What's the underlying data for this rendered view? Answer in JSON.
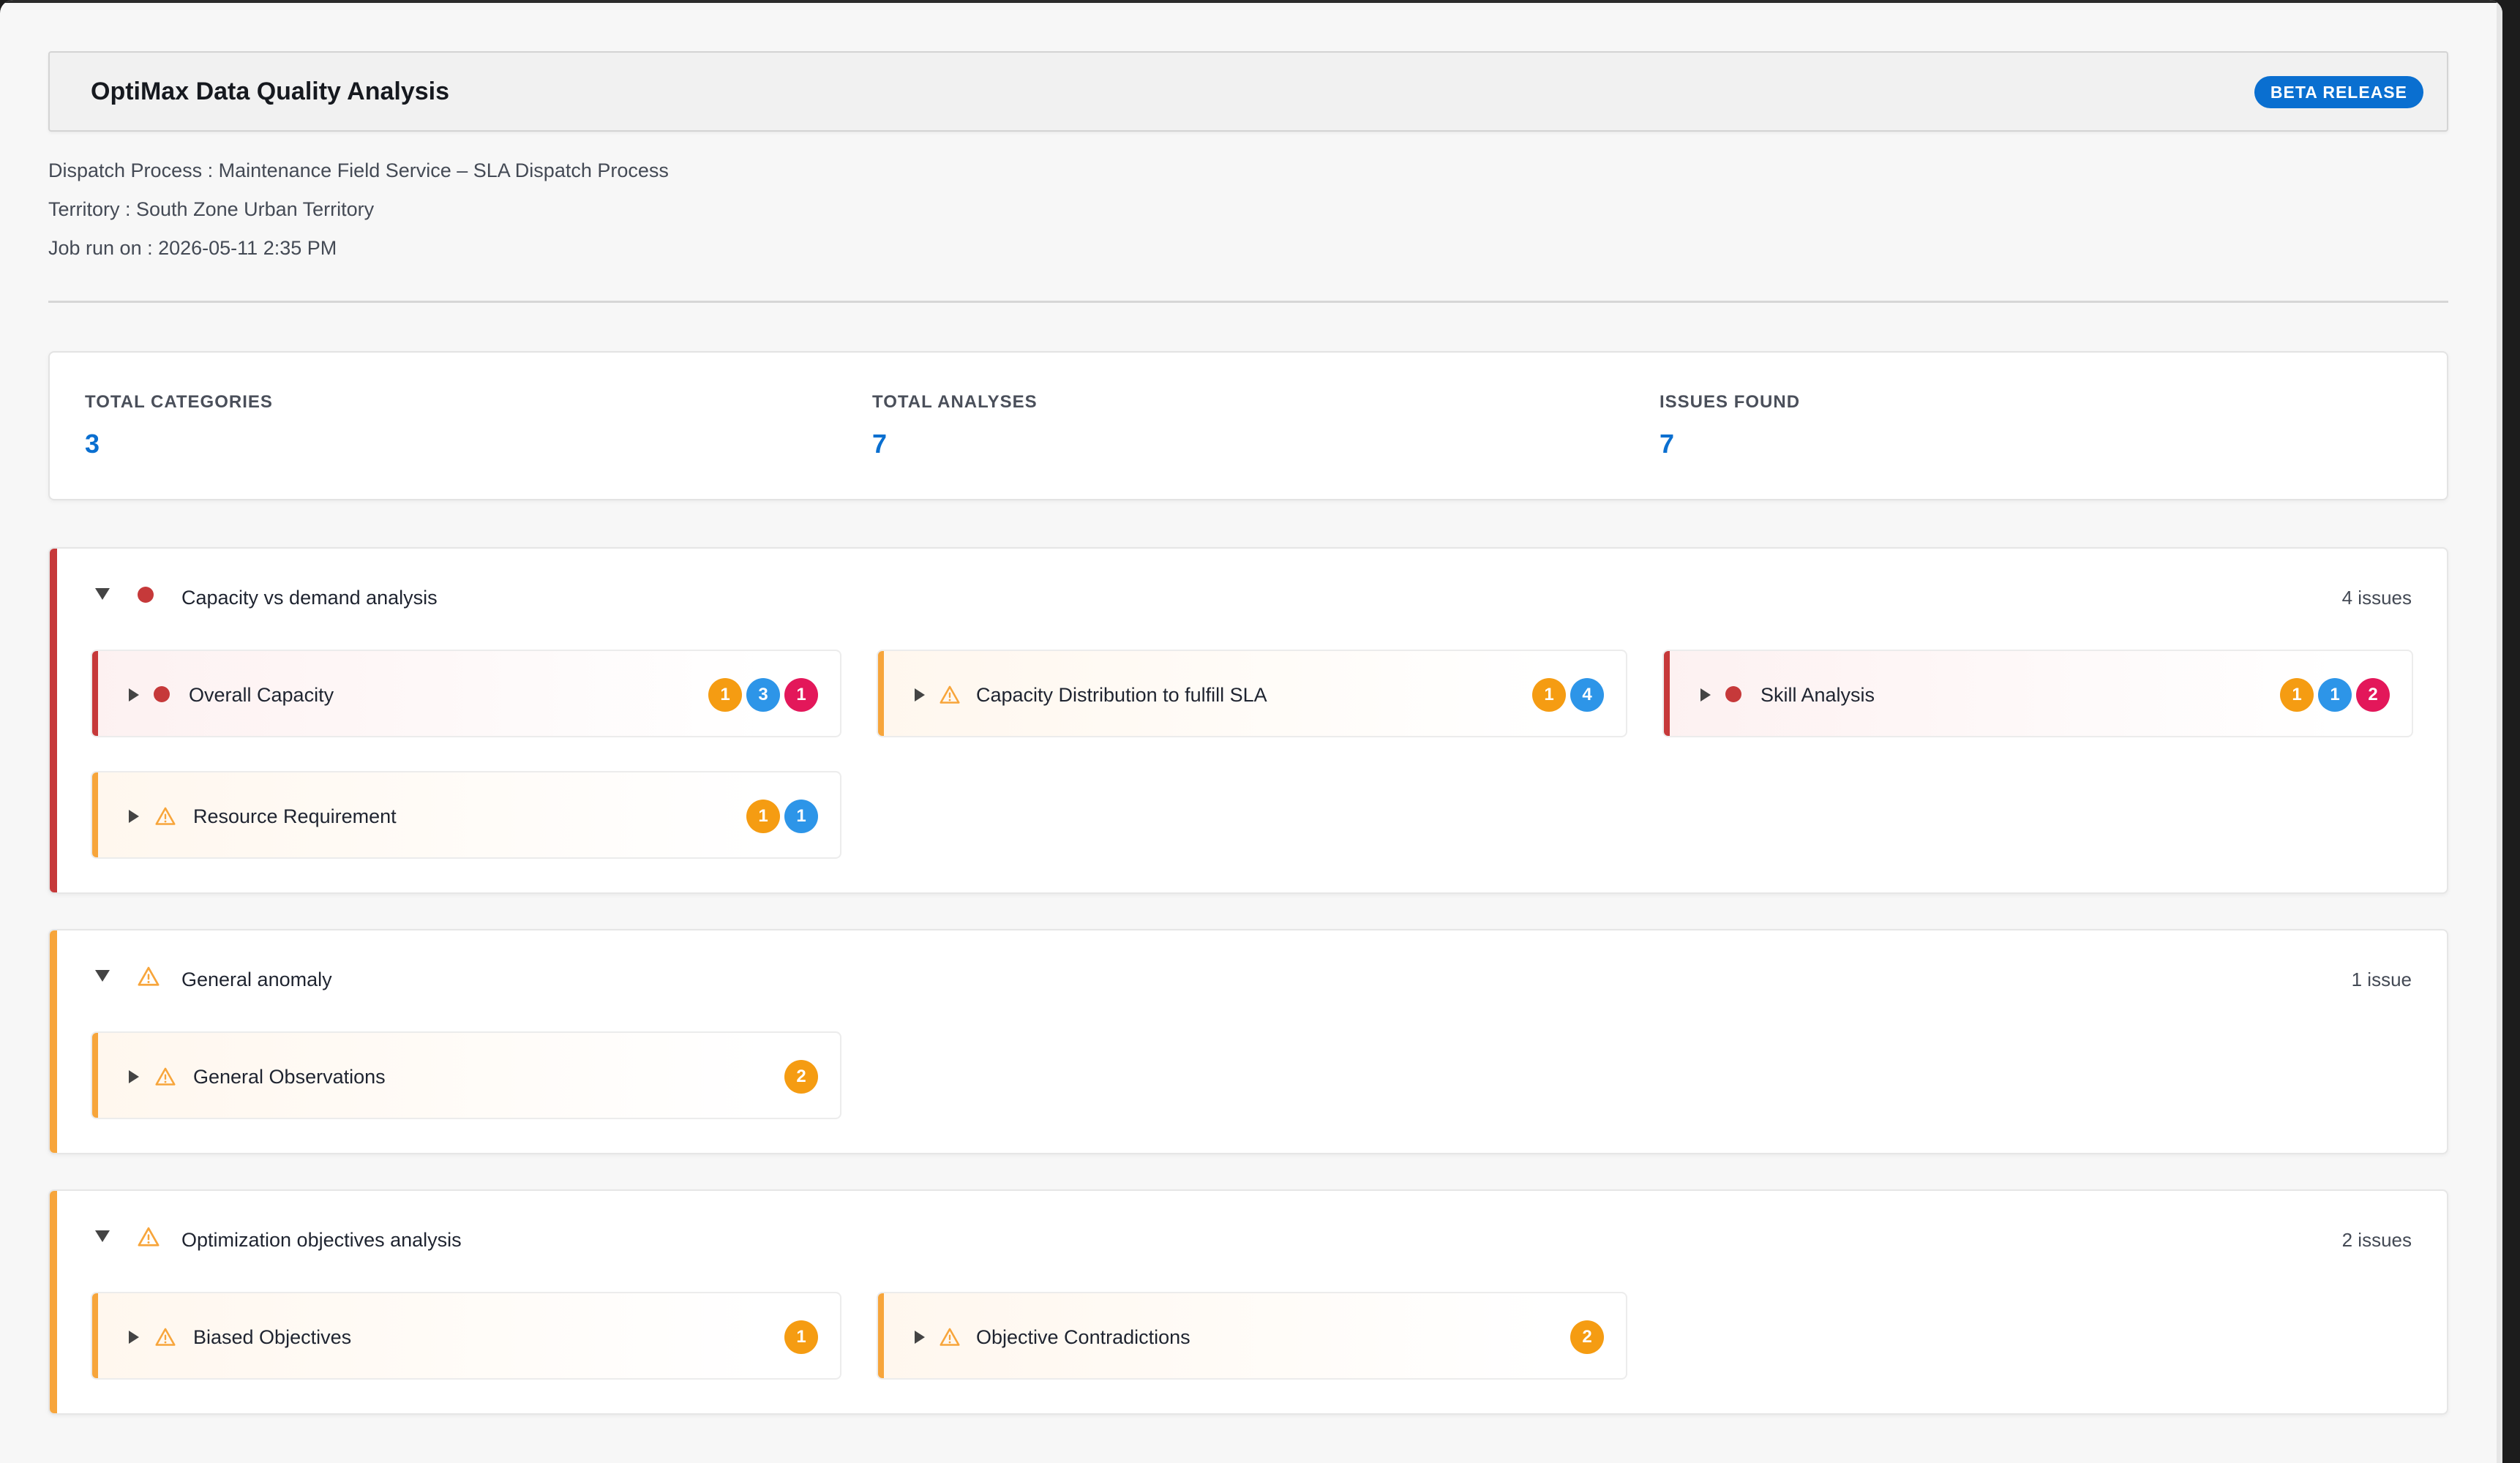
{
  "header": {
    "title": "OptiMax Data Quality Analysis",
    "badge": "BETA RELEASE"
  },
  "meta": {
    "dispatch_process": "Dispatch Process : Maintenance Field Service – SLA Dispatch Process",
    "territory": "Territory : South Zone Urban Territory",
    "job_run": "Job run on : 2026-05-11 2:35 PM"
  },
  "stats": {
    "total_categories": {
      "label": "TOTAL CATEGORIES",
      "value": "3"
    },
    "total_analyses": {
      "label": "TOTAL ANALYSES",
      "value": "7"
    },
    "issues_found": {
      "label": "ISSUES FOUND",
      "value": "7"
    }
  },
  "colors": {
    "accent_blue": "#0a6fd0",
    "error_red": "#c6393a",
    "warning_orange": "#f7a53b",
    "badge_orange": "#f59c12",
    "badge_blue": "#2d95e8",
    "badge_pink": "#e3175a"
  },
  "categories": [
    {
      "title": "Capacity vs demand analysis",
      "status_icon": "error-dot-icon",
      "count": "4 issues",
      "analyses": [
        {
          "title": "Overall Capacity",
          "status_icon": "error-dot-icon",
          "badges": [
            "1",
            "3",
            "1"
          ]
        },
        {
          "title": "Capacity Distribution to fulfill SLA",
          "status_icon": "warning-icon",
          "badges": [
            "1",
            "4"
          ]
        },
        {
          "title": "Skill Analysis",
          "status_icon": "error-dot-icon",
          "badges": [
            "1",
            "1",
            "2"
          ]
        },
        {
          "title": "Resource Requirement",
          "status_icon": "warning-icon",
          "badges": [
            "1",
            "1"
          ]
        }
      ]
    },
    {
      "title": "General anomaly",
      "status_icon": "warning-icon",
      "count": "1 issue",
      "analyses": [
        {
          "title": "General Observations",
          "status_icon": "warning-icon",
          "badges": [
            "2"
          ]
        }
      ]
    },
    {
      "title": "Optimization objectives analysis",
      "status_icon": "warning-icon",
      "count": "2 issues",
      "analyses": [
        {
          "title": "Biased Objectives",
          "status_icon": "warning-icon",
          "badges": [
            "1"
          ]
        },
        {
          "title": "Objective Contradictions",
          "status_icon": "warning-icon",
          "badges": [
            "2"
          ]
        }
      ]
    }
  ]
}
